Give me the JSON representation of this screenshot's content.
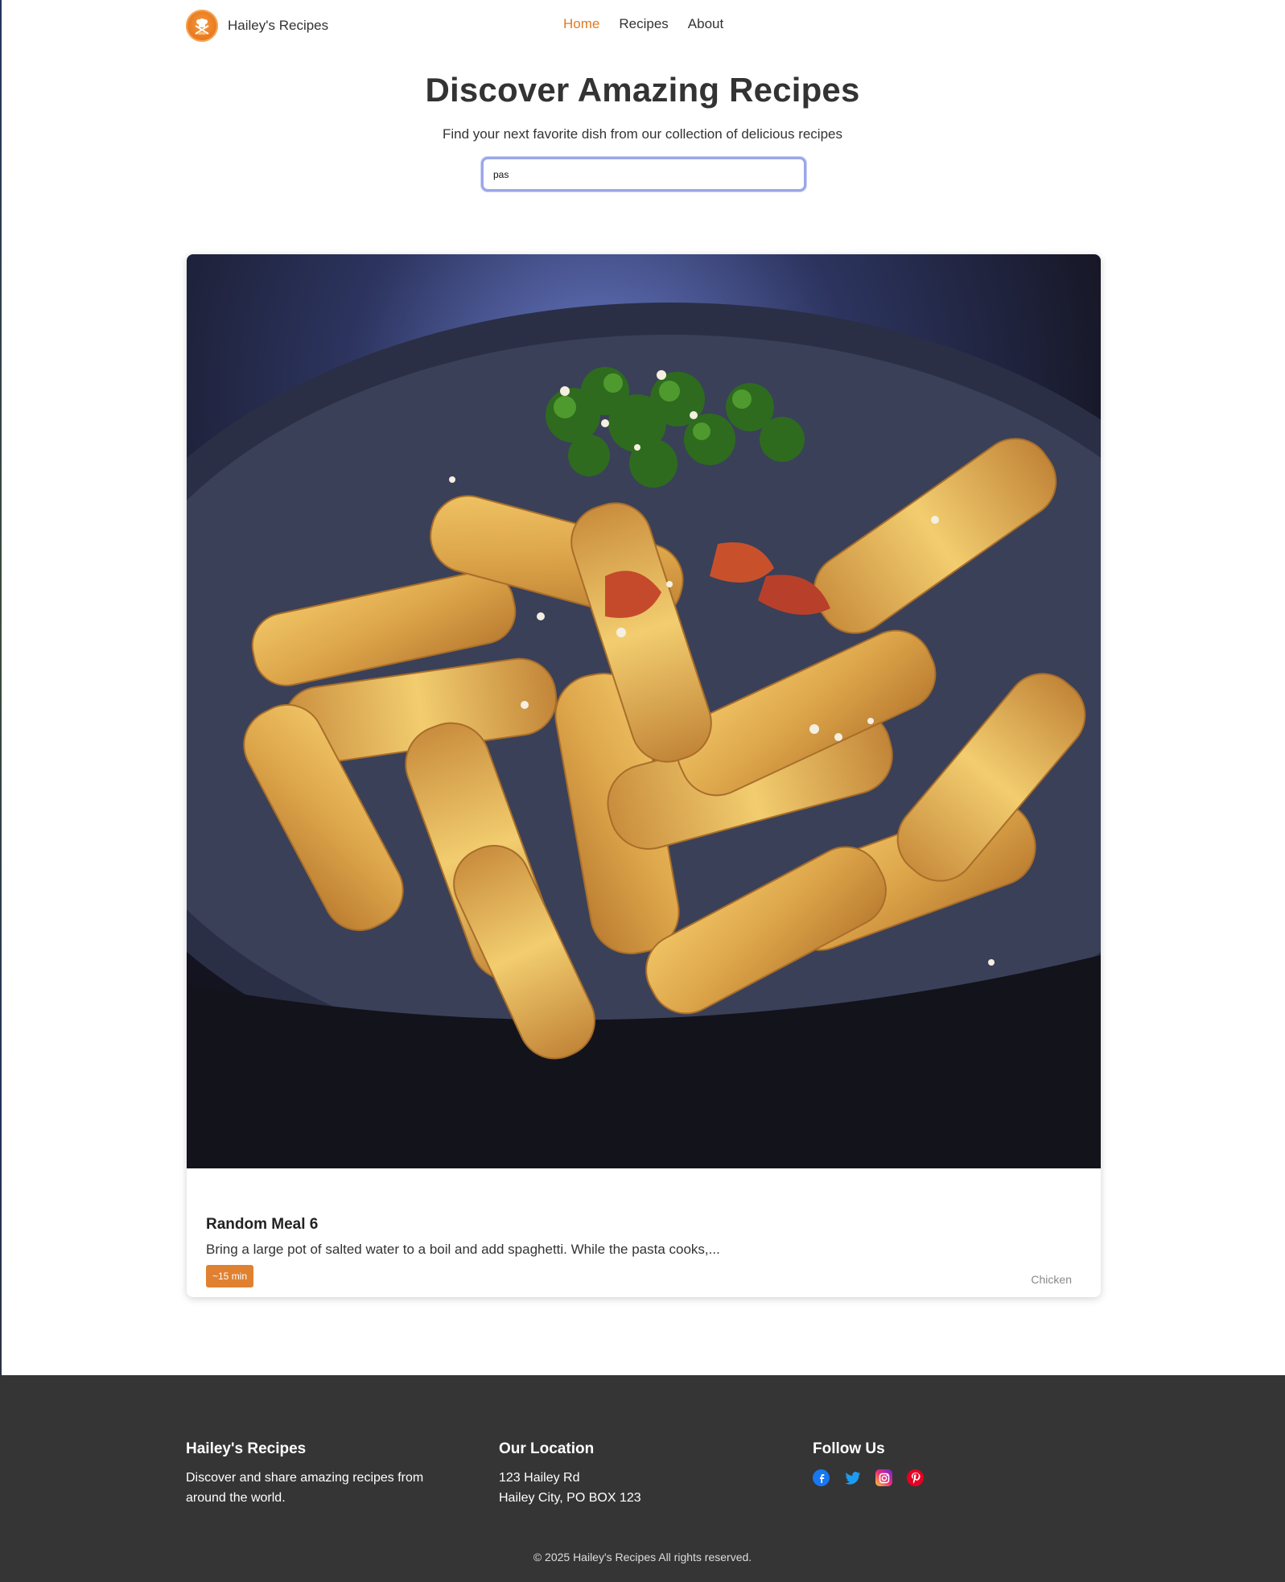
{
  "nav": {
    "brand": "Hailey's Recipes",
    "links": [
      {
        "label": "Home",
        "active": true
      },
      {
        "label": "Recipes",
        "active": false
      },
      {
        "label": "About",
        "active": false
      }
    ]
  },
  "hero": {
    "title": "Discover Amazing Recipes",
    "subtitle": "Find your next favorite dish from our collection of delicious recipes",
    "search_value": "pas"
  },
  "recipe": {
    "title": "Random Meal 6",
    "description": "Bring a large pot of salted water to a boil and add spaghetti. While the pasta cooks,...",
    "time_badge": "~15 min",
    "category": "Chicken"
  },
  "footer": {
    "about": {
      "title": "Hailey's Recipes",
      "text_line1": "Discover and share amazing recipes from",
      "text_line2": "around the world."
    },
    "location": {
      "title": "Our Location",
      "line1": "123 Hailey Rd",
      "line2": "Hailey City, PO BOX 123"
    },
    "follow": {
      "title": "Follow Us",
      "icons": [
        "facebook-icon",
        "twitter-icon",
        "instagram-icon",
        "pinterest-icon"
      ]
    },
    "copyright": "© 2025 Hailey's Recipes All rights reserved."
  },
  "colors": {
    "accent": "#e07b1e",
    "badge": "#e08131",
    "footer_bg": "#353535",
    "search_border": "#9aa7e8"
  }
}
